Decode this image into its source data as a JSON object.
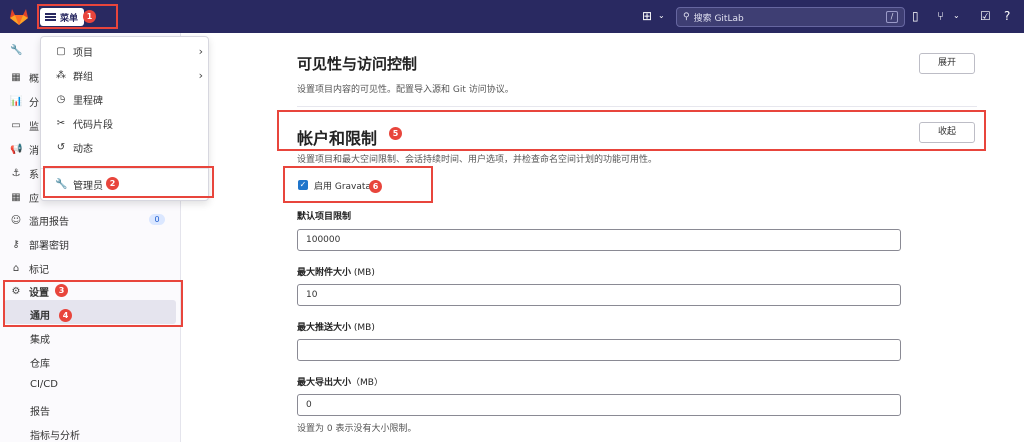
{
  "topbar": {
    "menu_label": "菜单",
    "search_placeholder": "搜索 GitLab",
    "search_shortcut": "/"
  },
  "sidebar": {
    "partial_items": [
      "概",
      "分",
      "监",
      "消",
      "系",
      "应"
    ],
    "items": [
      {
        "label": "滥用报告",
        "badge": "0",
        "icon": "emoji-icon"
      },
      {
        "label": "部署密钥",
        "icon": "key-icon"
      },
      {
        "label": "标记",
        "icon": "tag-icon"
      },
      {
        "label": "设置",
        "icon": "gear-icon"
      }
    ],
    "settings_sub": [
      "通用",
      "集成",
      "仓库",
      "CI/CD",
      "报告",
      "指标与分析"
    ]
  },
  "dropdown": {
    "items": [
      {
        "label": "项目",
        "icon": "project-icon",
        "has_submenu": true
      },
      {
        "label": "群组",
        "icon": "group-icon",
        "has_submenu": true
      },
      {
        "label": "里程碑",
        "icon": "clock-icon",
        "has_submenu": false
      },
      {
        "label": "代码片段",
        "icon": "scissors-icon",
        "has_submenu": false
      },
      {
        "label": "动态",
        "icon": "history-icon",
        "has_submenu": false
      },
      {
        "label": "管理员",
        "icon": "wrench-icon",
        "has_submenu": false
      }
    ]
  },
  "main": {
    "visibility": {
      "title": "可见性与访问控制",
      "description": "设置项目内容的可见性。配置导入源和 Git 访问协议。",
      "button": "展开"
    },
    "account": {
      "title": "帐户和限制",
      "description": "设置项目和最大空间限制、会话持续时间、用户选项，并检查命名空间计划的功能可用性。",
      "button": "收起",
      "gravatar_label": "启用 Gravatar",
      "gravatar_checked": true,
      "fields": [
        {
          "label": "默认项目限制",
          "unit": "",
          "value": "100000"
        },
        {
          "label": "最大附件大小",
          "unit": " (MB)",
          "value": "10"
        },
        {
          "label": "最大推送大小",
          "unit": " (MB)",
          "value": ""
        },
        {
          "label": "最大导出大小",
          "unit": "（MB）",
          "value": "0"
        }
      ],
      "help": "设置为 0 表示没有大小限制。"
    }
  },
  "annotations": [
    "1",
    "2",
    "3",
    "4",
    "5",
    "6"
  ],
  "colors": {
    "topbar": "#292961",
    "annotation": "#e8453c",
    "checkbox": "#1f75cb"
  }
}
